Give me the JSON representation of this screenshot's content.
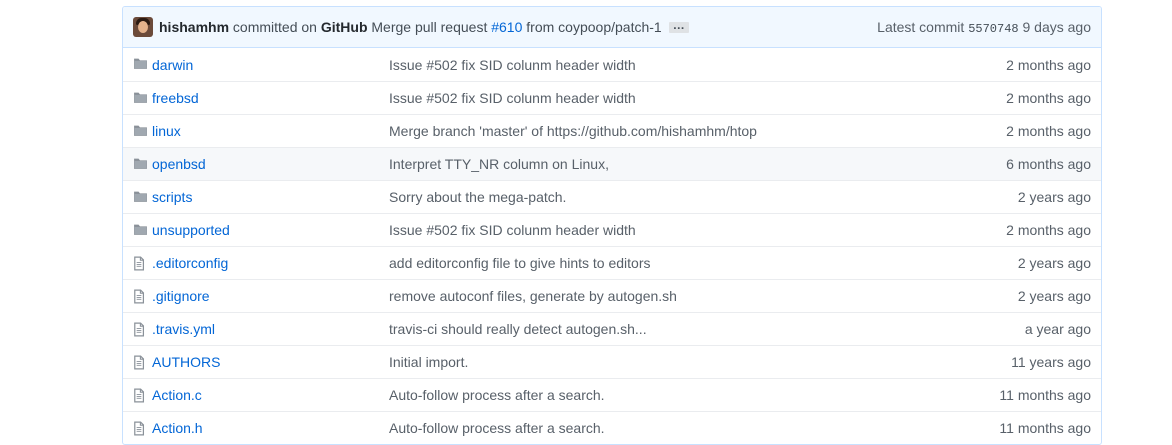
{
  "commit": {
    "author": "hishamhm",
    "committed_text": "committed on",
    "platform": "GitHub",
    "message_prefix": "Merge pull request",
    "pr_link": "#610",
    "message_suffix": "from coypoop/patch-1",
    "ellipsis": "…",
    "latest_label": "Latest commit",
    "sha": "5570748",
    "age": "9 days ago"
  },
  "files": [
    {
      "type": "folder",
      "icon": "folder-icon",
      "name": "darwin",
      "message": "Issue #502 fix SID colunm header width",
      "age": "2 months ago"
    },
    {
      "type": "folder",
      "icon": "folder-icon",
      "name": "freebsd",
      "message": "Issue #502 fix SID colunm header width",
      "age": "2 months ago"
    },
    {
      "type": "folder",
      "icon": "folder-icon",
      "name": "linux",
      "message": "Merge branch 'master' of https://github.com/hishamhm/htop",
      "age": "2 months ago"
    },
    {
      "type": "folder",
      "icon": "folder-icon",
      "name": "openbsd",
      "message": "Interpret TTY_NR column on Linux,",
      "age": "6 months ago"
    },
    {
      "type": "folder",
      "icon": "folder-icon",
      "name": "scripts",
      "message": "Sorry about the mega-patch.",
      "age": "2 years ago"
    },
    {
      "type": "folder",
      "icon": "folder-icon",
      "name": "unsupported",
      "message": "Issue #502 fix SID colunm header width",
      "age": "2 months ago"
    },
    {
      "type": "file",
      "icon": "file-icon",
      "name": ".editorconfig",
      "message": "add editorconfig file to give hints to editors",
      "age": "2 years ago"
    },
    {
      "type": "file",
      "icon": "file-icon",
      "name": ".gitignore",
      "message": "remove autoconf files, generate by autogen.sh",
      "age": "2 years ago"
    },
    {
      "type": "file",
      "icon": "file-icon",
      "name": ".travis.yml",
      "message": "travis-ci should really detect autogen.sh...",
      "age": "a year ago"
    },
    {
      "type": "file",
      "icon": "file-icon",
      "name": "AUTHORS",
      "message": "Initial import.",
      "age": "11 years ago"
    },
    {
      "type": "file",
      "icon": "file-icon",
      "name": "Action.c",
      "message": "Auto-follow process after a search.",
      "age": "11 months ago"
    },
    {
      "type": "file",
      "icon": "file-icon",
      "name": "Action.h",
      "message": "Auto-follow process after a search.",
      "age": "11 months ago"
    }
  ],
  "colors": {
    "link": "#0366d6",
    "muted": "#586069",
    "commit_bg": "#f1f8ff",
    "border": "#c8e1ff",
    "icon": "#8a9199"
  }
}
